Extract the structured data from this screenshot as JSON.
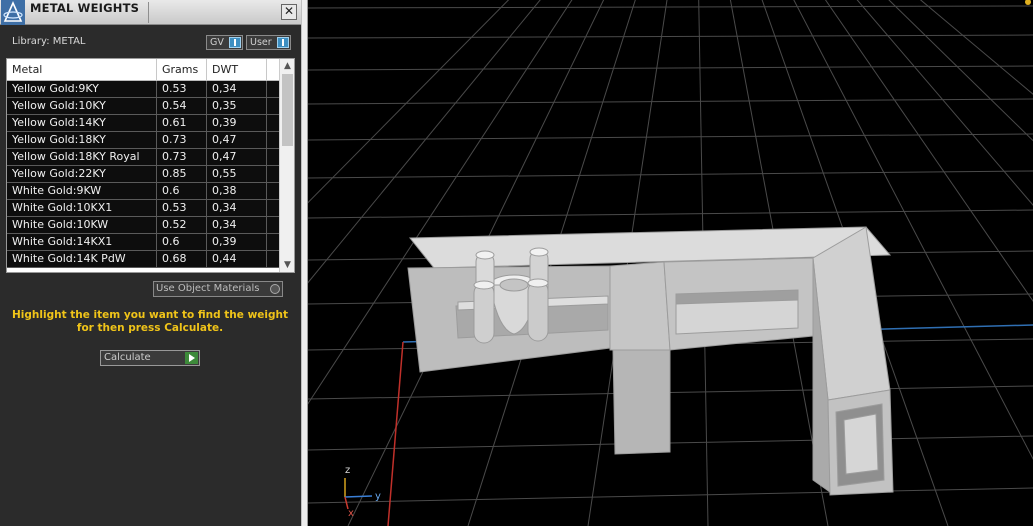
{
  "panel": {
    "title": "METAL WEIGHTS",
    "close_label": "✕",
    "library_label": "Library: METAL",
    "toggles": {
      "gv_label": "GV",
      "user_label": "User"
    },
    "table": {
      "columns": [
        "Metal",
        "Grams",
        "DWT"
      ],
      "rows": [
        [
          "Yellow Gold:9KY",
          "0.53",
          "0,34"
        ],
        [
          "Yellow Gold:10KY",
          "0.54",
          "0,35"
        ],
        [
          "Yellow Gold:14KY",
          "0.61",
          "0,39"
        ],
        [
          "Yellow Gold:18KY",
          "0.73",
          "0,47"
        ],
        [
          "Yellow Gold:18KY Royal",
          "0.73",
          "0,47"
        ],
        [
          "Yellow Gold:22KY",
          "0.85",
          "0,55"
        ],
        [
          "White Gold:9KW",
          "0.6",
          "0,38"
        ],
        [
          "White Gold:10KX1",
          "0.53",
          "0,34"
        ],
        [
          "White Gold:10KW",
          "0.52",
          "0,34"
        ],
        [
          "White Gold:14KX1",
          "0.6",
          "0,39"
        ],
        [
          "White Gold:14K PdW",
          "0.68",
          "0,44"
        ]
      ]
    },
    "use_object_materials_label": "Use Object Materials",
    "instructions_line1": "Highlight the item you want to find the weight",
    "instructions_line2": "for then press Calculate.",
    "calculate_label": "Calculate"
  },
  "viewport": {
    "axis_labels": {
      "z": "z",
      "y": "y",
      "x": "x"
    }
  },
  "colors": {
    "accent_yellow": "#f0c419",
    "toggle_blue": "#3d8fc2",
    "calc_green": "#3d8a3a"
  }
}
